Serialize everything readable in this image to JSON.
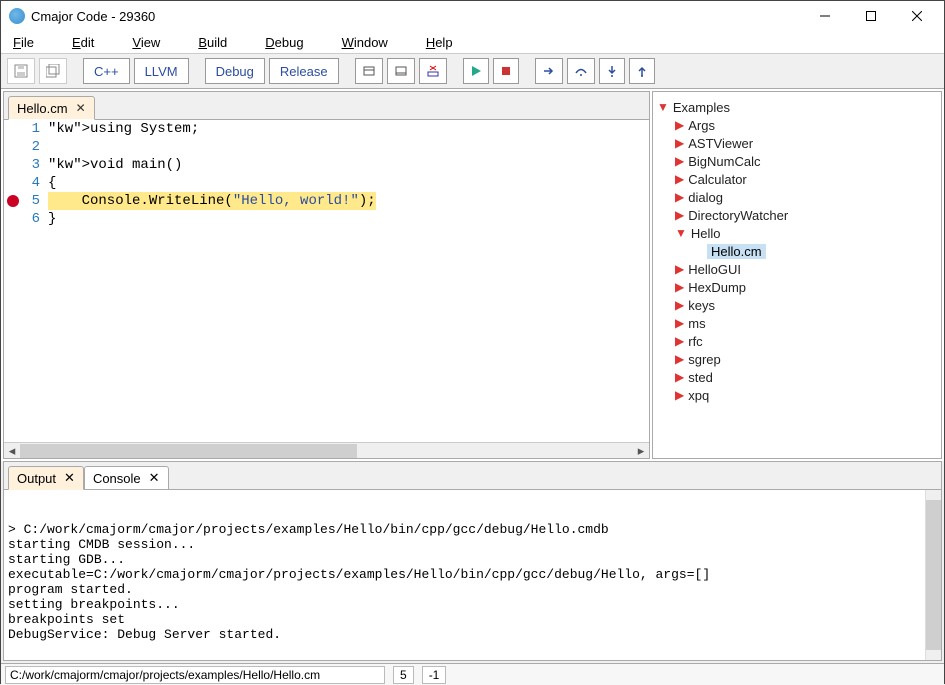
{
  "title": "Cmajor Code - 29360",
  "menu": {
    "items": [
      "File",
      "Edit",
      "View",
      "Build",
      "Debug",
      "Window",
      "Help"
    ]
  },
  "toolbar": {
    "cpp": "C++",
    "llvm": "LLVM",
    "debug": "Debug",
    "release": "Release"
  },
  "editor": {
    "tab": {
      "label": "Hello.cm"
    },
    "lines": [
      {
        "n": 1,
        "bp": false,
        "html": "using System;"
      },
      {
        "n": 2,
        "bp": false,
        "html": ""
      },
      {
        "n": 3,
        "bp": false,
        "html": "void main()"
      },
      {
        "n": 4,
        "bp": false,
        "html": "{"
      },
      {
        "n": 5,
        "bp": true,
        "html": "    Console.WriteLine(\"Hello, world!\");"
      },
      {
        "n": 6,
        "bp": false,
        "html": "}"
      }
    ]
  },
  "tree": {
    "root": "Examples",
    "items": [
      "Args",
      "ASTViewer",
      "BigNumCalc",
      "Calculator",
      "dialog",
      "DirectoryWatcher"
    ],
    "hello": {
      "label": "Hello",
      "child": "Hello.cm"
    },
    "rest": [
      "HelloGUI",
      "HexDump",
      "keys",
      "ms",
      "rfc",
      "sgrep",
      "sted",
      "xpq"
    ]
  },
  "bottom": {
    "tabs": {
      "output": "Output",
      "console": "Console"
    },
    "lines": [
      "> C:/work/cmajorm/cmajor/projects/examples/Hello/bin/cpp/gcc/debug/Hello.cmdb",
      "starting CMDB session...",
      "starting GDB...",
      "executable=C:/work/cmajorm/cmajor/projects/examples/Hello/bin/cpp/gcc/debug/Hello, args=[]",
      "program started.",
      "setting breakpoints...",
      "breakpoints set",
      "DebugService: Debug Server started."
    ]
  },
  "status": {
    "path": "C:/work/cmajorm/cmajor/projects/examples/Hello/Hello.cm",
    "line": "5",
    "col": "-1"
  }
}
